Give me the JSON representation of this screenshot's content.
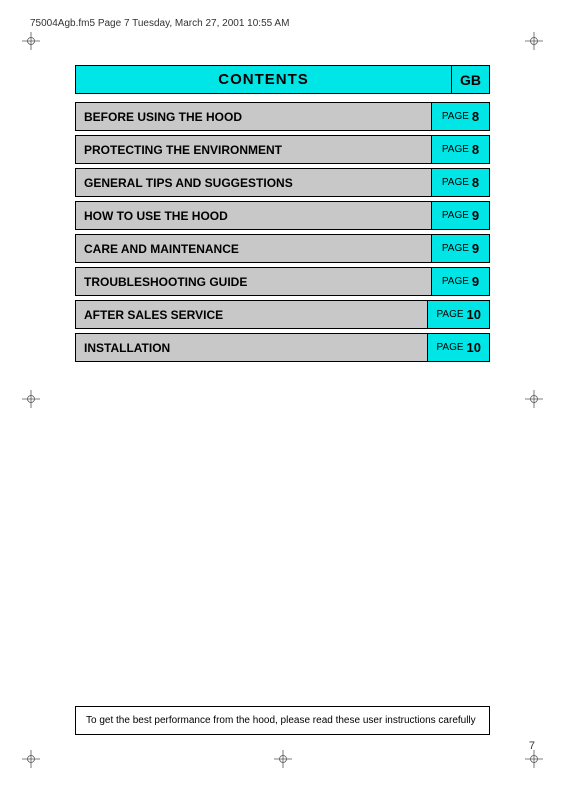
{
  "header": {
    "filename": "75004Agb.fm5  Page 7  Tuesday, March 27, 2001  10:55 AM"
  },
  "contents": {
    "title": "CONTENTS",
    "gb_label": "GB"
  },
  "toc": {
    "rows": [
      {
        "label": "BEFORE USING THE HOOD",
        "page_word": "PAGE",
        "page_num": "8"
      },
      {
        "label": "PROTECTING THE ENVIRONMENT",
        "page_word": "PAGE",
        "page_num": "8"
      },
      {
        "label": "GENERAL TIPS AND SUGGESTIONS",
        "page_word": "PAGE",
        "page_num": "8"
      },
      {
        "label": "HOW TO USE THE HOOD",
        "page_word": "PAGE",
        "page_num": "9"
      },
      {
        "label": "CARE AND MAINTENANCE",
        "page_word": "PAGE",
        "page_num": "9"
      },
      {
        "label": "TROUBLESHOOTING GUIDE",
        "page_word": "PAGE",
        "page_num": "9"
      },
      {
        "label": "AFTER SALES SERVICE",
        "page_word": "PAGE",
        "page_num": "10"
      },
      {
        "label": "INSTALLATION",
        "page_word": "PAGE",
        "page_num": "10"
      }
    ]
  },
  "bottom_note": {
    "text": "To get the best performance from the hood, please read these user instructions carefully"
  },
  "page_number": "7"
}
